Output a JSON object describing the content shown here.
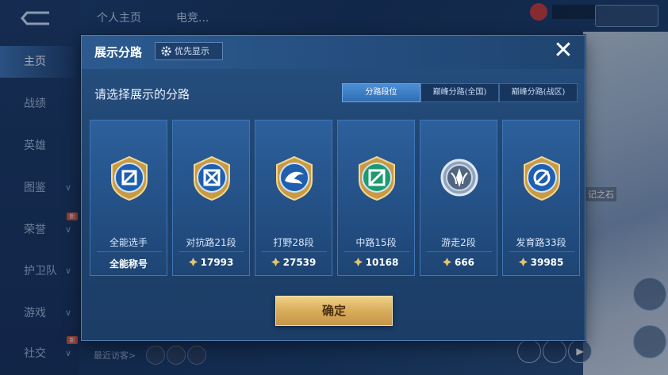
{
  "background": {
    "back_icon": "back-arrow-icon",
    "top_tabs": [
      "个人主页",
      "电竞..."
    ],
    "left_nav": [
      {
        "label": "主页",
        "active": true
      },
      {
        "label": "战绩"
      },
      {
        "label": "英雄"
      },
      {
        "label": "图鉴",
        "chevron": true
      },
      {
        "label": "荣誉",
        "chevron": true,
        "badge": "新"
      },
      {
        "label": "护卫队",
        "chevron": true
      },
      {
        "label": "游戏",
        "chevron": true
      },
      {
        "label": "社交",
        "chevron": true,
        "badge": "新"
      }
    ],
    "visitors_label": "最近访客>",
    "right_label": "记之石"
  },
  "modal": {
    "title": "展示分路",
    "priority_button": "优先显示",
    "close_icon": "close-icon",
    "subtitle": "请选择展示的分路",
    "segments": [
      {
        "label": "分路段位",
        "active": true
      },
      {
        "label": "巅峰分路(全国)",
        "active": false
      },
      {
        "label": "巅峰分路(战区)",
        "active": false
      }
    ],
    "cards": [
      {
        "name": "全能选手",
        "score": "全能称号",
        "emblem": "all-round-emblem-icon",
        "show_icon": false
      },
      {
        "name": "对抗路21段",
        "score": "17993",
        "emblem": "clash-lane-emblem-icon",
        "show_icon": true
      },
      {
        "name": "打野28段",
        "score": "27539",
        "emblem": "jungle-emblem-icon",
        "show_icon": true
      },
      {
        "name": "中路15段",
        "score": "10168",
        "emblem": "mid-lane-emblem-icon",
        "show_icon": true
      },
      {
        "name": "游走2段",
        "score": "666",
        "emblem": "roam-emblem-icon",
        "show_icon": true
      },
      {
        "name": "发育路33段",
        "score": "39985",
        "emblem": "farm-lane-emblem-icon",
        "show_icon": true
      }
    ],
    "confirm_button": "确定"
  },
  "colors": {
    "accent_blue": "#4d8fd6",
    "gold": "#d8ad5b",
    "card_bg": "#2d609c"
  }
}
